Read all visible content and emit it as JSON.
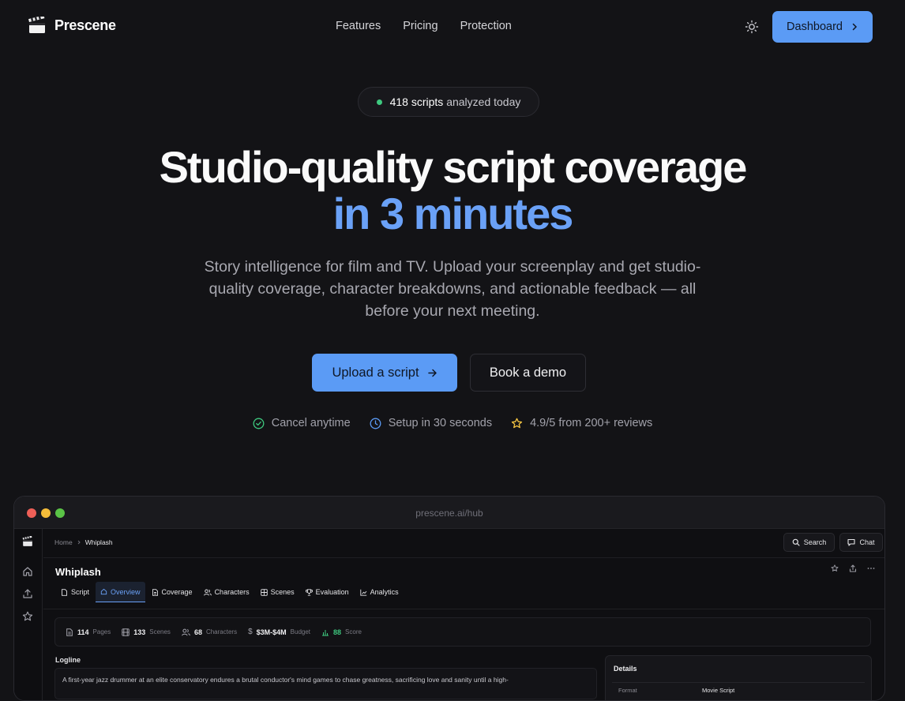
{
  "nav": {
    "brand": "Prescene",
    "links": [
      "Features",
      "Pricing",
      "Protection"
    ],
    "dashboard_label": "Dashboard"
  },
  "hero": {
    "pill_count": "418 scripts",
    "pill_rest": "analyzed today",
    "title_line1": "Studio-quality script coverage",
    "title_line2": "in 3 minutes",
    "subtitle": "Story intelligence for film and TV. Upload your screenplay and get studio-quality coverage, character breakdowns, and actionable feedback — all before your next meeting.",
    "cta_primary": "Upload a script",
    "cta_secondary": "Book a demo",
    "trust": [
      "Cancel anytime",
      "Setup in 30 seconds",
      "4.9/5 from 200+ reviews"
    ]
  },
  "browser": {
    "url": "prescene.ai/hub",
    "breadcrumb": [
      "Home",
      "Whiplash"
    ],
    "search_label": "Search",
    "chat_label": "Chat",
    "doc_title": "Whiplash",
    "tabs": [
      "Script",
      "Overview",
      "Coverage",
      "Characters",
      "Scenes",
      "Evaluation",
      "Analytics"
    ],
    "active_tab": "Overview",
    "stats": [
      {
        "value": "114",
        "label": "Pages"
      },
      {
        "value": "133",
        "label": "Scenes"
      },
      {
        "value": "68",
        "label": "Characters"
      },
      {
        "value": "$3M-$4M",
        "label": "Budget"
      },
      {
        "value": "88",
        "label": "Score"
      }
    ],
    "logline_label": "Logline",
    "logline_text": "A first-year jazz drummer at an elite conservatory endures a brutal conductor's mind games to chase greatness, sacrificing love and sanity until a high-",
    "details_label": "Details",
    "details_row": {
      "key": "Format",
      "value": "Movie Script"
    }
  },
  "colors": {
    "accent": "#5b9bf5",
    "accent_text": "#6aa1f7",
    "background": "#131316",
    "success": "#3ec97f",
    "star": "#f5c542"
  }
}
